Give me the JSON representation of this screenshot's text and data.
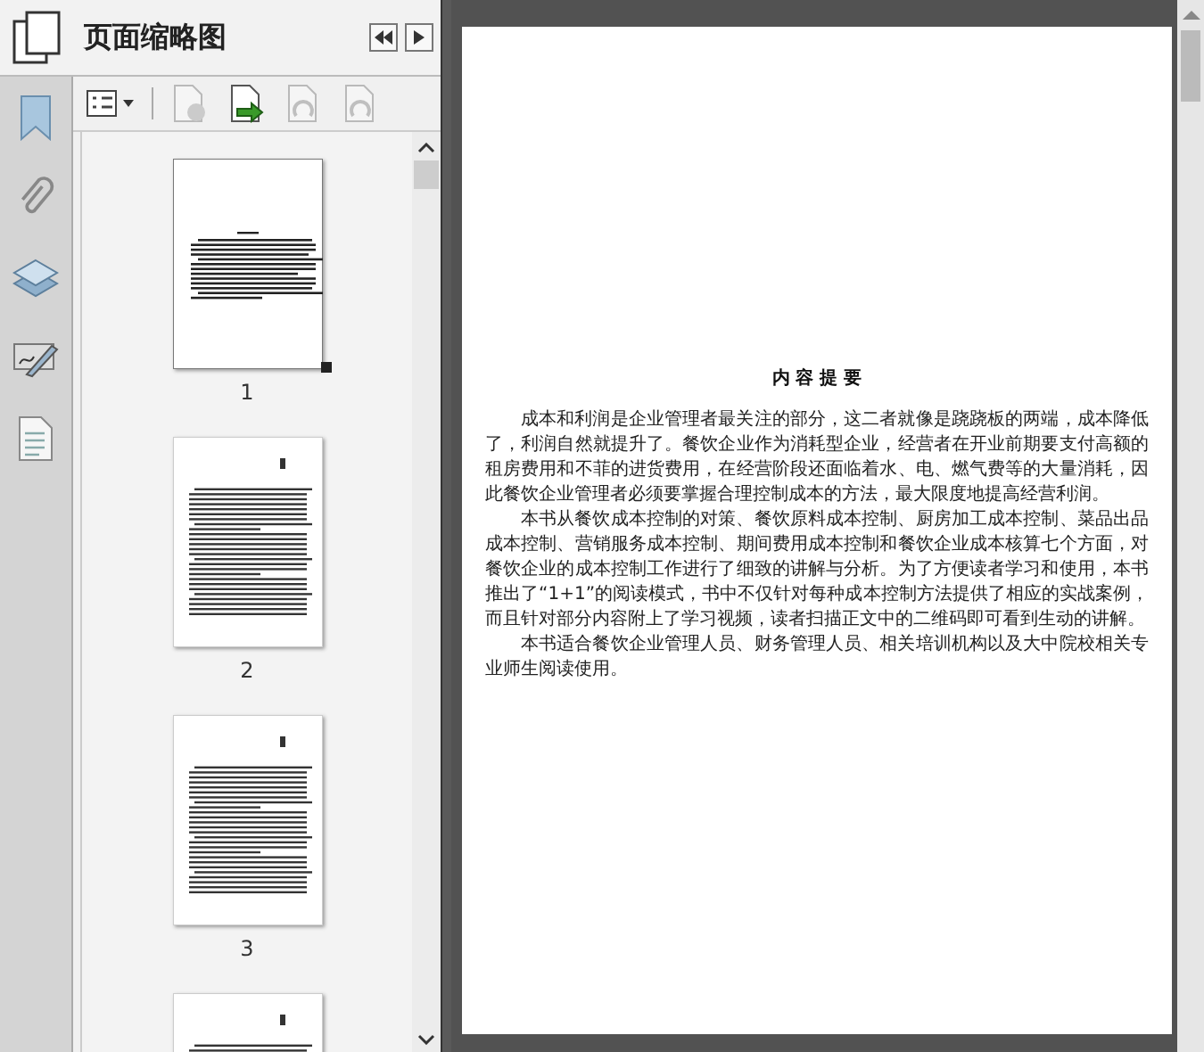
{
  "panel": {
    "title": "页面缩略图"
  },
  "sidebar": {
    "items": [
      {
        "kind": "bookmark"
      },
      {
        "kind": "attachment"
      },
      {
        "kind": "layers"
      },
      {
        "kind": "signature"
      },
      {
        "kind": "content"
      }
    ]
  },
  "toolbar": [
    {
      "kind": "options",
      "disabled": false
    },
    {
      "kind": "delete",
      "disabled": true
    },
    {
      "kind": "insert",
      "disabled": false
    },
    {
      "kind": "undo",
      "disabled": true
    },
    {
      "kind": "redo",
      "disabled": true
    }
  ],
  "thumbnails": [
    {
      "label": "1",
      "selected": true,
      "kind": "summary"
    },
    {
      "label": "2",
      "selected": false,
      "kind": "text"
    },
    {
      "label": "3",
      "selected": false,
      "kind": "text"
    },
    {
      "kind": "text",
      "selected": false
    }
  ],
  "page": {
    "title": "内 容 提 要",
    "paragraphs": [
      "成本和利润是企业管理者最关注的部分，这二者就像是跷跷板的两端，成本降低了，利润自然就提升了。餐饮企业作为消耗型企业，经营者在开业前期要支付高额的租房费用和不菲的进货费用，在经营阶段还面临着水、电、燃气费等的大量消耗，因此餐饮企业管理者必须要掌握合理控制成本的方法，最大限度地提高经营利润。",
      "本书从餐饮成本控制的对策、餐饮原料成本控制、厨房加工成本控制、菜品出品成本控制、营销服务成本控制、期间费用成本控制和餐饮企业成本核算七个方面，对餐饮企业的成本控制工作进行了细致的讲解与分析。为了方便读者学习和使用，本书推出了“1+1”的阅读模式，书中不仅针对每种成本控制方法提供了相应的实战案例，而且针对部分内容附上了学习视频，读者扫描正文中的二维码即可看到生动的讲解。",
      "本书适合餐饮企业管理人员、财务管理人员、相关培训机构以及大中院校相关专业师生阅读使用。"
    ]
  }
}
